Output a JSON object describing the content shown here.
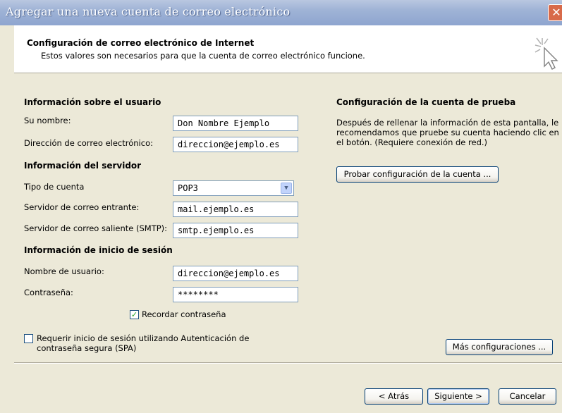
{
  "window": {
    "title": "Agregar una nueva cuenta de correo electrónico",
    "close_glyph": "✕"
  },
  "header": {
    "title": "Configuración de correo electrónico de Internet",
    "subtitle": "Estos valores son necesarios para que la cuenta de correo electrónico funcione."
  },
  "user_info": {
    "section": "Información sobre el usuario",
    "name_label": "Su nombre:",
    "name_value": "Don Nombre Ejemplo",
    "email_label": "Dirección de correo electrónico:",
    "email_value": "direccion@ejemplo.es"
  },
  "server_info": {
    "section": "Información del servidor",
    "account_type_label": "Tipo de cuenta",
    "account_type_value": "POP3",
    "incoming_label": "Servidor de correo entrante:",
    "incoming_value": "mail.ejemplo.es",
    "outgoing_label": "Servidor de correo saliente (SMTP):",
    "outgoing_value": "smtp.ejemplo.es"
  },
  "login_info": {
    "section": "Información de inicio de sesión",
    "username_label": "Nombre de usuario:",
    "username_value": "direccion@ejemplo.es",
    "password_label": "Contraseña:",
    "password_value": "********",
    "remember_label": "Recordar contraseña",
    "remember_checked": true,
    "spa_label_line1": "Requerir inicio de sesión utilizando Autenticación de",
    "spa_label_line2": "contraseña segura (SPA)",
    "spa_checked": false
  },
  "test": {
    "section": "Configuración de la cuenta de prueba",
    "description_line1": "Después de rellenar la información de esta pantalla, le",
    "description_line2": "recomendamos que pruebe su cuenta haciendo clic en",
    "description_line3": "el botón. (Requiere conexión de red.)",
    "test_button": "Probar configuración de la cuenta ...",
    "more_button": "Más configuraciones ..."
  },
  "footer": {
    "back_button": "< Atrás",
    "next_button": "Siguiente >",
    "cancel_button": "Cancelar"
  },
  "colors": {
    "title_bar": "#9fb3d6",
    "dialog_bg": "#ece9d8",
    "field_border": "#7f9db9",
    "check_mark": "#21a121"
  },
  "icons": {
    "wizard": "wizard-cursor-icon",
    "dropdown": "chevron-down-icon",
    "check": "checkmark-icon"
  }
}
